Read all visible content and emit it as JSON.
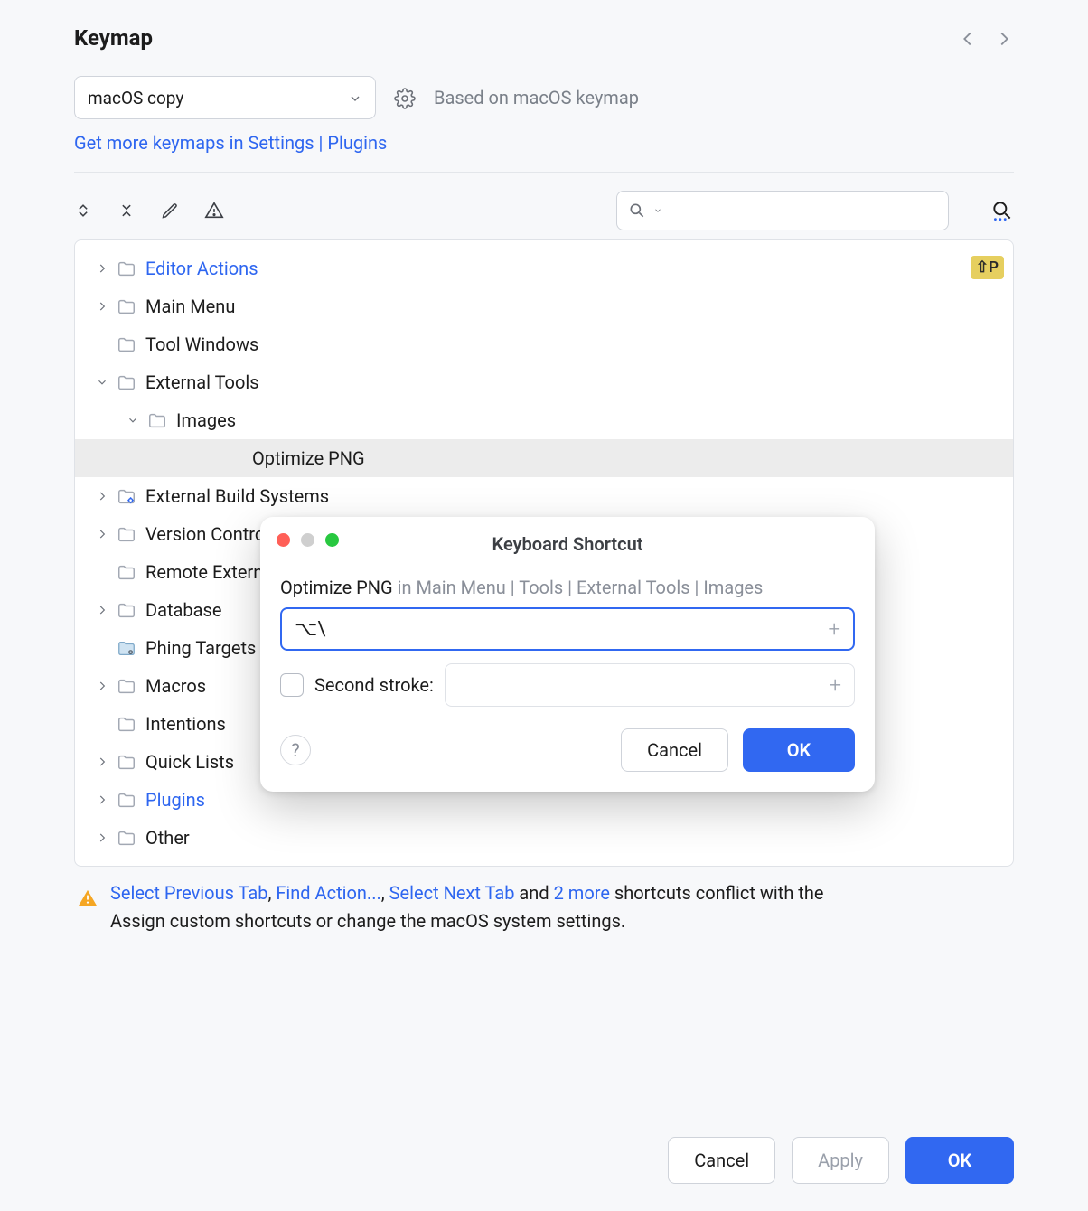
{
  "header": {
    "title": "Keymap"
  },
  "keymap_select": {
    "value": "macOS copy",
    "based_on": "Based on macOS keymap"
  },
  "links": {
    "more_keymaps": "Get more keymaps in Settings | Plugins"
  },
  "search": {
    "placeholder": ""
  },
  "shortcut_chip": "⇧P",
  "tree": [
    {
      "label": "Editor Actions",
      "expandable": true,
      "expanded": false,
      "link": true,
      "indent": 0,
      "has_chip": true
    },
    {
      "label": "Main Menu",
      "expandable": true,
      "expanded": false,
      "link": false,
      "indent": 0
    },
    {
      "label": "Tool Windows",
      "expandable": false,
      "expanded": false,
      "link": false,
      "indent": 0
    },
    {
      "label": "External Tools",
      "expandable": true,
      "expanded": true,
      "link": false,
      "indent": 0
    },
    {
      "label": "Images",
      "expandable": true,
      "expanded": true,
      "link": false,
      "indent": 1
    },
    {
      "label": "Optimize PNG",
      "expandable": false,
      "expanded": false,
      "link": false,
      "indent": 2,
      "selected": true,
      "no_icon": true
    },
    {
      "label": "External Build Systems",
      "expandable": true,
      "expanded": false,
      "link": false,
      "indent": 0,
      "gear": true
    },
    {
      "label": "Version Control",
      "expandable": true,
      "expanded": false,
      "link": false,
      "indent": 0
    },
    {
      "label": "Remote Externa",
      "expandable": false,
      "expanded": false,
      "link": false,
      "indent": 0
    },
    {
      "label": "Database",
      "expandable": true,
      "expanded": false,
      "link": false,
      "indent": 0
    },
    {
      "label": "Phing Targets",
      "expandable": false,
      "expanded": false,
      "link": false,
      "indent": 0,
      "special": true
    },
    {
      "label": "Macros",
      "expandable": true,
      "expanded": false,
      "link": false,
      "indent": 0
    },
    {
      "label": "Intentions",
      "expandable": false,
      "expanded": false,
      "link": false,
      "indent": 0
    },
    {
      "label": "Quick Lists",
      "expandable": true,
      "expanded": false,
      "link": false,
      "indent": 0
    },
    {
      "label": "Plugins",
      "expandable": true,
      "expanded": false,
      "link": true,
      "indent": 0
    },
    {
      "label": "Other",
      "expandable": true,
      "expanded": false,
      "link": false,
      "indent": 0
    }
  ],
  "warning": {
    "links": [
      "Select Previous Tab",
      "Find Action...",
      "Select Next Tab",
      "2 more"
    ],
    "mid": " and ",
    "tail1": " shortcuts conflict with the",
    "line2": "Assign custom shortcuts or change the macOS system settings."
  },
  "dialog": {
    "title": "Keyboard Shortcut",
    "action": "Optimize PNG",
    "path": " in Main Menu | Tools | External Tools | Images",
    "stroke": "⌥\\",
    "second_label": "Second stroke:",
    "cancel": "Cancel",
    "ok": "OK"
  },
  "footer": {
    "cancel": "Cancel",
    "apply": "Apply",
    "ok": "OK"
  }
}
